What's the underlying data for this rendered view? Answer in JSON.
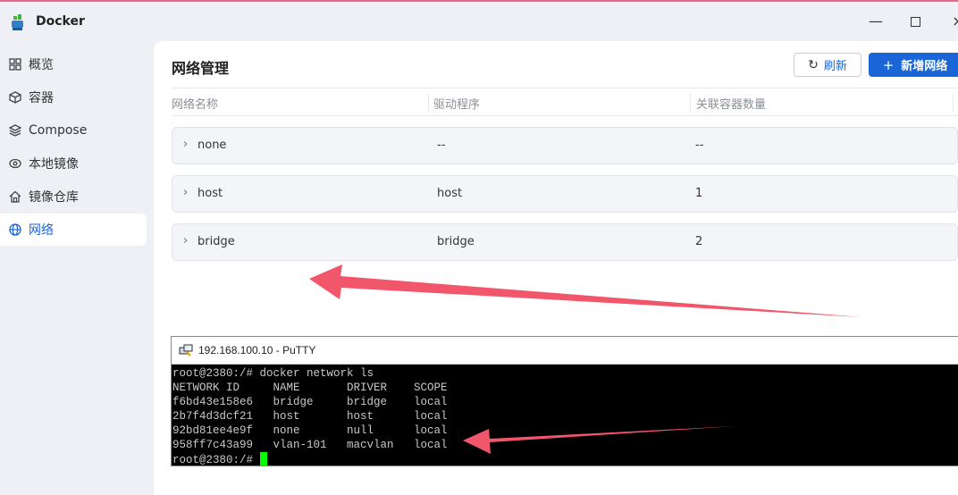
{
  "window": {
    "title": "Docker"
  },
  "sidebar": {
    "items": [
      {
        "label": "概览",
        "icon": "grid-icon",
        "active": false
      },
      {
        "label": "容器",
        "icon": "cube-icon",
        "active": false
      },
      {
        "label": "Compose",
        "icon": "layers-icon",
        "active": false
      },
      {
        "label": "本地镜像",
        "icon": "disk-icon",
        "active": false
      },
      {
        "label": "镜像仓库",
        "icon": "home-icon",
        "active": false
      },
      {
        "label": "网络",
        "icon": "globe-icon",
        "active": true
      }
    ]
  },
  "main": {
    "title": "网络管理",
    "refresh_label": "刷新",
    "add_label": "新增网络",
    "columns": [
      "网络名称",
      "驱动程序",
      "关联容器数量"
    ],
    "rows": [
      {
        "name": "none",
        "driver": "--",
        "count": "--"
      },
      {
        "name": "host",
        "driver": "host",
        "count": "1"
      },
      {
        "name": "bridge",
        "driver": "bridge",
        "count": "2"
      }
    ]
  },
  "putty": {
    "title": "192.168.100.10 - PuTTY",
    "lines": [
      "root@2380:/# docker network ls",
      "NETWORK ID     NAME       DRIVER    SCOPE",
      "f6bd43e158e6   bridge     bridge    local",
      "2b7f4d3dcf21   host       host      local",
      "92bd81ee4e9f   none       null      local",
      "958ff7c43a99   vlan-101   macvlan   local"
    ],
    "prompt": "root@2380:/# "
  },
  "colors": {
    "accent": "#1a66d9",
    "arrow": "#f2566b",
    "cursor": "#00ff00"
  }
}
